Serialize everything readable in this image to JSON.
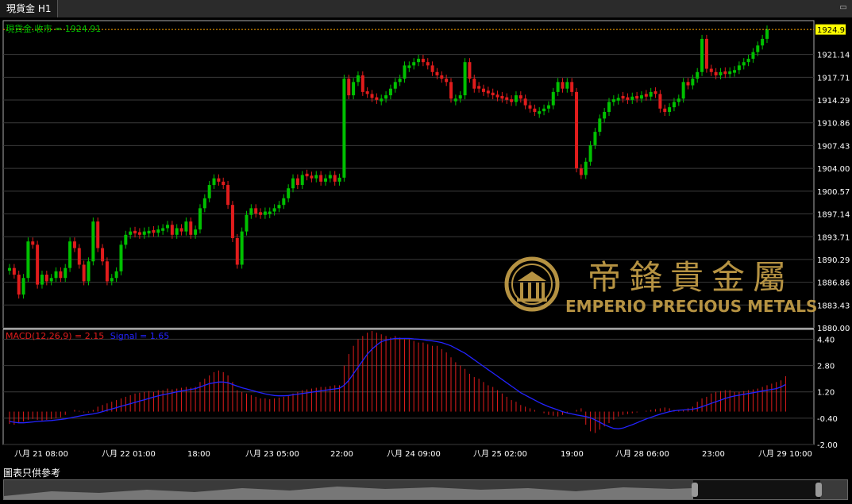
{
  "tab": {
    "title": "現貨金 H1"
  },
  "chart_data": [
    {
      "type": "candlestick",
      "title": "現貨金.收市 = 1924.91",
      "last_price_label": "1924.91",
      "ylim": [
        1880.0,
        1926.0
      ],
      "y_ticks": [
        "1921.14",
        "1917.71",
        "1914.29",
        "1910.86",
        "1907.43",
        "1904.00",
        "1900.57",
        "1897.14",
        "1893.71",
        "1890.29",
        "1886.86",
        "1883.43",
        "1880.00"
      ],
      "x_ticks": [
        "八月 21 08:00",
        "八月 22 01:00",
        "18:00",
        "八月 23 05:00",
        "22:00",
        "八月 24 09:00",
        "八月 25 02:00",
        "19:00",
        "八月 28 06:00",
        "23:00",
        "八月 29 10:00"
      ],
      "close": [
        1889.0,
        1888.0,
        1885.0,
        1887.5,
        1893.0,
        1892.5,
        1886.5,
        1888.0,
        1887.0,
        1887.5,
        1888.5,
        1887.5,
        1889.0,
        1893.0,
        1892.0,
        1889.5,
        1887.0,
        1890.0,
        1896.0,
        1892.0,
        1890.0,
        1887.0,
        1887.5,
        1888.5,
        1892.5,
        1894.0,
        1894.5,
        1894.2,
        1894.0,
        1894.5,
        1894.6,
        1894.3,
        1894.8,
        1895.0,
        1895.5,
        1894.0,
        1895.0,
        1894.5,
        1896.0,
        1894.0,
        1894.8,
        1898.0,
        1899.5,
        1901.5,
        1902.5,
        1902.0,
        1901.5,
        1898.5,
        1893.5,
        1889.5,
        1894.5,
        1897.0,
        1898.0,
        1897.2,
        1897.0,
        1897.5,
        1897.5,
        1898.0,
        1898.5,
        1899.5,
        1901.0,
        1902.5,
        1901.5,
        1903.0,
        1902.8,
        1902.5,
        1903.0,
        1902.0,
        1902.5,
        1903.0,
        1902.0,
        1902.6,
        1917.5,
        1915.0,
        1917.0,
        1918.0,
        1915.5,
        1915.2,
        1914.6,
        1914.3,
        1914.5,
        1915.0,
        1916.0,
        1917.0,
        1917.5,
        1919.5,
        1919.5,
        1920.0,
        1920.5,
        1920.0,
        1919.5,
        1918.5,
        1918.0,
        1917.5,
        1917.0,
        1914.5,
        1914.5,
        1915.0,
        1920.0,
        1917.5,
        1916.0,
        1916.0,
        1915.5,
        1915.3,
        1915.0,
        1914.7,
        1914.5,
        1914.3,
        1914.0,
        1915.0,
        1914.5,
        1913.5,
        1913.0,
        1912.5,
        1912.6,
        1913.0,
        1913.5,
        1915.5,
        1917.0,
        1916.0,
        1917.0,
        1915.5,
        1904.0,
        1903.0,
        1905.0,
        1907.5,
        1909.5,
        1911.5,
        1912.5,
        1914.0,
        1914.4,
        1914.6,
        1914.5,
        1914.3,
        1914.8,
        1914.5,
        1915.0,
        1914.8,
        1915.5,
        1915.2,
        1913.0,
        1912.5,
        1913.2,
        1914.0,
        1914.5,
        1917.0,
        1916.5,
        1917.5,
        1918.5,
        1923.5,
        1919.0,
        1918.5,
        1918.0,
        1918.5,
        1918.2,
        1918.6,
        1918.8,
        1919.5,
        1920.0,
        1920.5,
        1921.5,
        1922.5,
        1923.5,
        1924.91
      ],
      "candle_dir": [
        "up",
        "down",
        "down",
        "up",
        "up",
        "down",
        "down",
        "up",
        "down",
        "up",
        "up",
        "down",
        "up",
        "up",
        "down",
        "down",
        "down",
        "up",
        "up",
        "down",
        "down",
        "down",
        "up",
        "up",
        "up",
        "up",
        "up",
        "down",
        "down",
        "up",
        "up",
        "down",
        "up",
        "up",
        "up",
        "down",
        "up",
        "down",
        "up",
        "down",
        "up",
        "up",
        "up",
        "up",
        "up",
        "down",
        "down",
        "down",
        "down",
        "down",
        "up",
        "up",
        "up",
        "down",
        "down",
        "up",
        "up",
        "up",
        "up",
        "up",
        "up",
        "up",
        "down",
        "up",
        "down",
        "down",
        "up",
        "down",
        "up",
        "up",
        "down",
        "up",
        "up",
        "down",
        "up",
        "up",
        "down",
        "down",
        "down",
        "down",
        "up",
        "up",
        "up",
        "up",
        "up",
        "up",
        "up",
        "up",
        "up",
        "down",
        "down",
        "down",
        "down",
        "down",
        "down",
        "down",
        "up",
        "up",
        "up",
        "down",
        "down",
        "down",
        "down",
        "down",
        "down",
        "down",
        "down",
        "down",
        "down",
        "up",
        "down",
        "down",
        "down",
        "down",
        "up",
        "up",
        "up",
        "up",
        "up",
        "down",
        "up",
        "down",
        "down",
        "down",
        "up",
        "up",
        "up",
        "up",
        "up",
        "up",
        "up",
        "up",
        "down",
        "down",
        "up",
        "down",
        "up",
        "down",
        "up",
        "down",
        "down",
        "down",
        "up",
        "up",
        "up",
        "up",
        "down",
        "up",
        "up",
        "up",
        "down",
        "down",
        "down",
        "up",
        "down",
        "up",
        "up",
        "up",
        "up",
        "up",
        "up",
        "up",
        "up",
        "up"
      ],
      "macd": [
        -0.75,
        -0.8,
        -0.7,
        -0.6,
        -0.5,
        -0.45,
        -0.5,
        -0.55,
        -0.5,
        -0.45,
        -0.4,
        -0.35,
        -0.2,
        0.0,
        0.1,
        0.05,
        -0.05,
        -0.05,
        0.1,
        0.3,
        0.4,
        0.5,
        0.6,
        0.7,
        0.8,
        0.9,
        1.0,
        1.1,
        1.15,
        1.2,
        1.25,
        1.2,
        1.3,
        1.3,
        1.4,
        1.35,
        1.4,
        1.45,
        1.5,
        1.45,
        1.5,
        1.8,
        2.0,
        2.2,
        2.4,
        2.5,
        2.4,
        2.2,
        1.8,
        1.3,
        1.2,
        1.1,
        1.0,
        0.9,
        0.8,
        0.8,
        0.75,
        0.8,
        0.85,
        0.9,
        1.0,
        1.1,
        1.2,
        1.3,
        1.35,
        1.4,
        1.45,
        1.5,
        1.5,
        1.55,
        1.6,
        1.6,
        2.8,
        3.5,
        4.0,
        4.4,
        4.6,
        4.8,
        4.9,
        4.8,
        4.7,
        4.6,
        4.5,
        4.6,
        4.5,
        4.4,
        4.4,
        4.3,
        4.2,
        4.2,
        4.1,
        4.0,
        4.0,
        3.8,
        3.6,
        3.3,
        3.0,
        2.8,
        2.6,
        2.3,
        2.1,
        2.0,
        1.8,
        1.6,
        1.5,
        1.3,
        1.1,
        0.9,
        0.7,
        0.6,
        0.4,
        0.3,
        0.2,
        0.1,
        0.0,
        -0.1,
        -0.2,
        -0.25,
        -0.3,
        -0.2,
        -0.1,
        0.0,
        0.1,
        0.2,
        -0.8,
        -1.2,
        -1.3,
        -1.1,
        -0.9,
        -0.7,
        -0.5,
        -0.3,
        -0.2,
        -0.15,
        -0.1,
        -0.05,
        0.0,
        0.05,
        0.1,
        0.15,
        0.2,
        0.25,
        0.2,
        0.1,
        0.05,
        0.1,
        0.2,
        0.3,
        0.6,
        0.8,
        0.9,
        1.1,
        1.2,
        1.25,
        1.3,
        1.3,
        1.2,
        1.2,
        1.25,
        1.3,
        1.35,
        1.4,
        1.5,
        1.6,
        1.7,
        1.8,
        1.9,
        2.15
      ],
      "signal": [
        -0.6,
        -0.65,
        -0.68,
        -0.68,
        -0.66,
        -0.63,
        -0.6,
        -0.58,
        -0.56,
        -0.54,
        -0.51,
        -0.48,
        -0.44,
        -0.39,
        -0.33,
        -0.27,
        -0.22,
        -0.18,
        -0.14,
        -0.08,
        0.0,
        0.08,
        0.16,
        0.24,
        0.32,
        0.4,
        0.48,
        0.56,
        0.64,
        0.72,
        0.8,
        0.88,
        0.96,
        1.02,
        1.08,
        1.14,
        1.2,
        1.25,
        1.3,
        1.35,
        1.4,
        1.5,
        1.6,
        1.7,
        1.75,
        1.8,
        1.8,
        1.75,
        1.65,
        1.55,
        1.45,
        1.38,
        1.3,
        1.22,
        1.15,
        1.08,
        1.02,
        0.98,
        0.96,
        0.96,
        0.98,
        1.02,
        1.06,
        1.1,
        1.14,
        1.18,
        1.22,
        1.26,
        1.3,
        1.34,
        1.38,
        1.42,
        1.6,
        1.9,
        2.3,
        2.7,
        3.1,
        3.5,
        3.8,
        4.05,
        4.25,
        4.35,
        4.4,
        4.45,
        4.45,
        4.45,
        4.45,
        4.42,
        4.4,
        4.37,
        4.33,
        4.3,
        4.25,
        4.2,
        4.1,
        4.0,
        3.85,
        3.7,
        3.55,
        3.35,
        3.15,
        2.95,
        2.75,
        2.55,
        2.35,
        2.15,
        1.95,
        1.75,
        1.55,
        1.35,
        1.15,
        1.0,
        0.85,
        0.7,
        0.55,
        0.42,
        0.3,
        0.2,
        0.1,
        0.0,
        -0.08,
        -0.14,
        -0.2,
        -0.25,
        -0.3,
        -0.38,
        -0.5,
        -0.65,
        -0.8,
        -0.92,
        -1.02,
        -1.05,
        -1.0,
        -0.9,
        -0.8,
        -0.68,
        -0.56,
        -0.45,
        -0.35,
        -0.25,
        -0.16,
        -0.08,
        0.0,
        0.05,
        0.08,
        0.1,
        0.12,
        0.15,
        0.2,
        0.3,
        0.4,
        0.5,
        0.6,
        0.7,
        0.8,
        0.88,
        0.95,
        1.0,
        1.05,
        1.1,
        1.15,
        1.2,
        1.25,
        1.3,
        1.35,
        1.4,
        1.5,
        1.65
      ]
    },
    {
      "type": "bar",
      "title": "MACD(12,26,9) = 2.15",
      "signal_label": "Signal = 1.65",
      "ylim": [
        -2.0,
        5.0
      ],
      "y_ticks": [
        "4.40",
        "2.80",
        "1.20",
        "-0.40",
        "-2.00"
      ],
      "series": [
        {
          "name": "MACD(12,26,9)",
          "type": "bar",
          "color": "#e01c1c"
        },
        {
          "name": "Signal",
          "type": "line",
          "color": "#2323ff"
        }
      ]
    }
  ],
  "watermark": {
    "cn": "帝鋒貴金屬",
    "en": "EMPERIO PRECIOUS METALS"
  },
  "footer": {
    "note": "圖表只供參考"
  },
  "colors": {
    "up": "#00c000",
    "down": "#e01c1c",
    "price_label": "#ffff00",
    "grid": "#3a3a3a",
    "title": "#00c000",
    "macd": "#e01c1c",
    "signal": "#2323ff",
    "gold": "#c9a24a"
  }
}
